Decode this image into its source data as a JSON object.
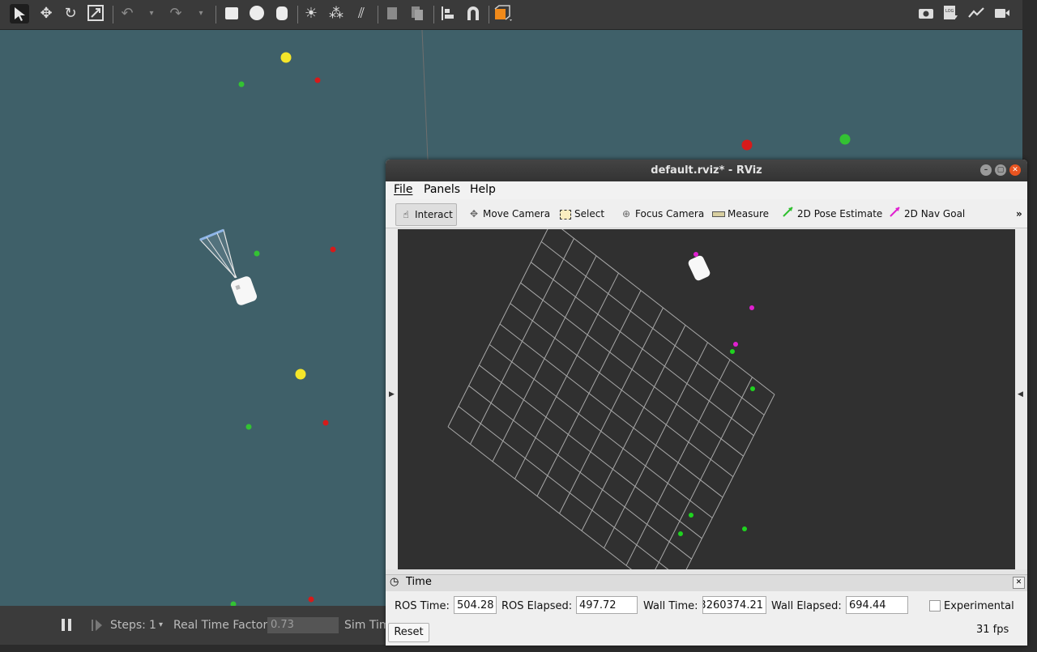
{
  "gazebo": {
    "toolbar_icons": [
      "select-arrow-icon",
      "translate-icon",
      "rotate-icon",
      "scale-icon",
      "undo-icon",
      "undo-dropdown-icon",
      "redo-icon",
      "redo-dropdown-icon",
      "box-icon",
      "sphere-icon",
      "cylinder-icon",
      "point-light-icon",
      "spot-light-icon",
      "directional-light-icon",
      "copy-icon",
      "paste-icon",
      "align-icon",
      "magnet-icon",
      "view-angle-icon"
    ],
    "right_icons": [
      "screenshot-icon",
      "log-icon",
      "plot-icon",
      "record-video-icon"
    ],
    "bottom": {
      "pause_icon": "pause-icon",
      "step_icon": "step-icon",
      "steps_label": "Steps:",
      "steps_value": "1",
      "rtf_label": "Real Time Factor:",
      "rtf_value": "0.73",
      "sim_time_label": "Sim Tim"
    },
    "accent_colors": {
      "yellow": "#f5e62a",
      "red": "#d61a1a",
      "green": "#33c233",
      "scene": "#3f6069"
    }
  },
  "rviz": {
    "title": "default.rviz* - RViz",
    "menu": [
      "File",
      "Panels",
      "Help"
    ],
    "tools": [
      {
        "label": "Interact",
        "icon": "hand-pointer-icon",
        "active": true
      },
      {
        "label": "Move Camera",
        "icon": "move-camera-icon"
      },
      {
        "label": "Select",
        "icon": "select-box-icon"
      },
      {
        "label": "Focus Camera",
        "icon": "focus-camera-icon"
      },
      {
        "label": "Measure",
        "icon": "ruler-icon"
      },
      {
        "label": "2D Pose Estimate",
        "icon": "green-arrow-icon"
      },
      {
        "label": "2D Nav Goal",
        "icon": "magenta-arrow-icon"
      }
    ],
    "more_glyph": "»",
    "time_panel": {
      "title": "Time",
      "ros_time_label": "ROS Time:",
      "ros_time": "504.28",
      "ros_elapsed_label": "ROS Elapsed:",
      "ros_elapsed": "497.72",
      "wall_time_label": "Wall Time:",
      "wall_time": "3260374.21",
      "wall_elapsed_label": "Wall Elapsed:",
      "wall_elapsed": "694.44",
      "experimental_label": "Experimental",
      "reset_label": "Reset",
      "fps": "31 fps"
    }
  }
}
